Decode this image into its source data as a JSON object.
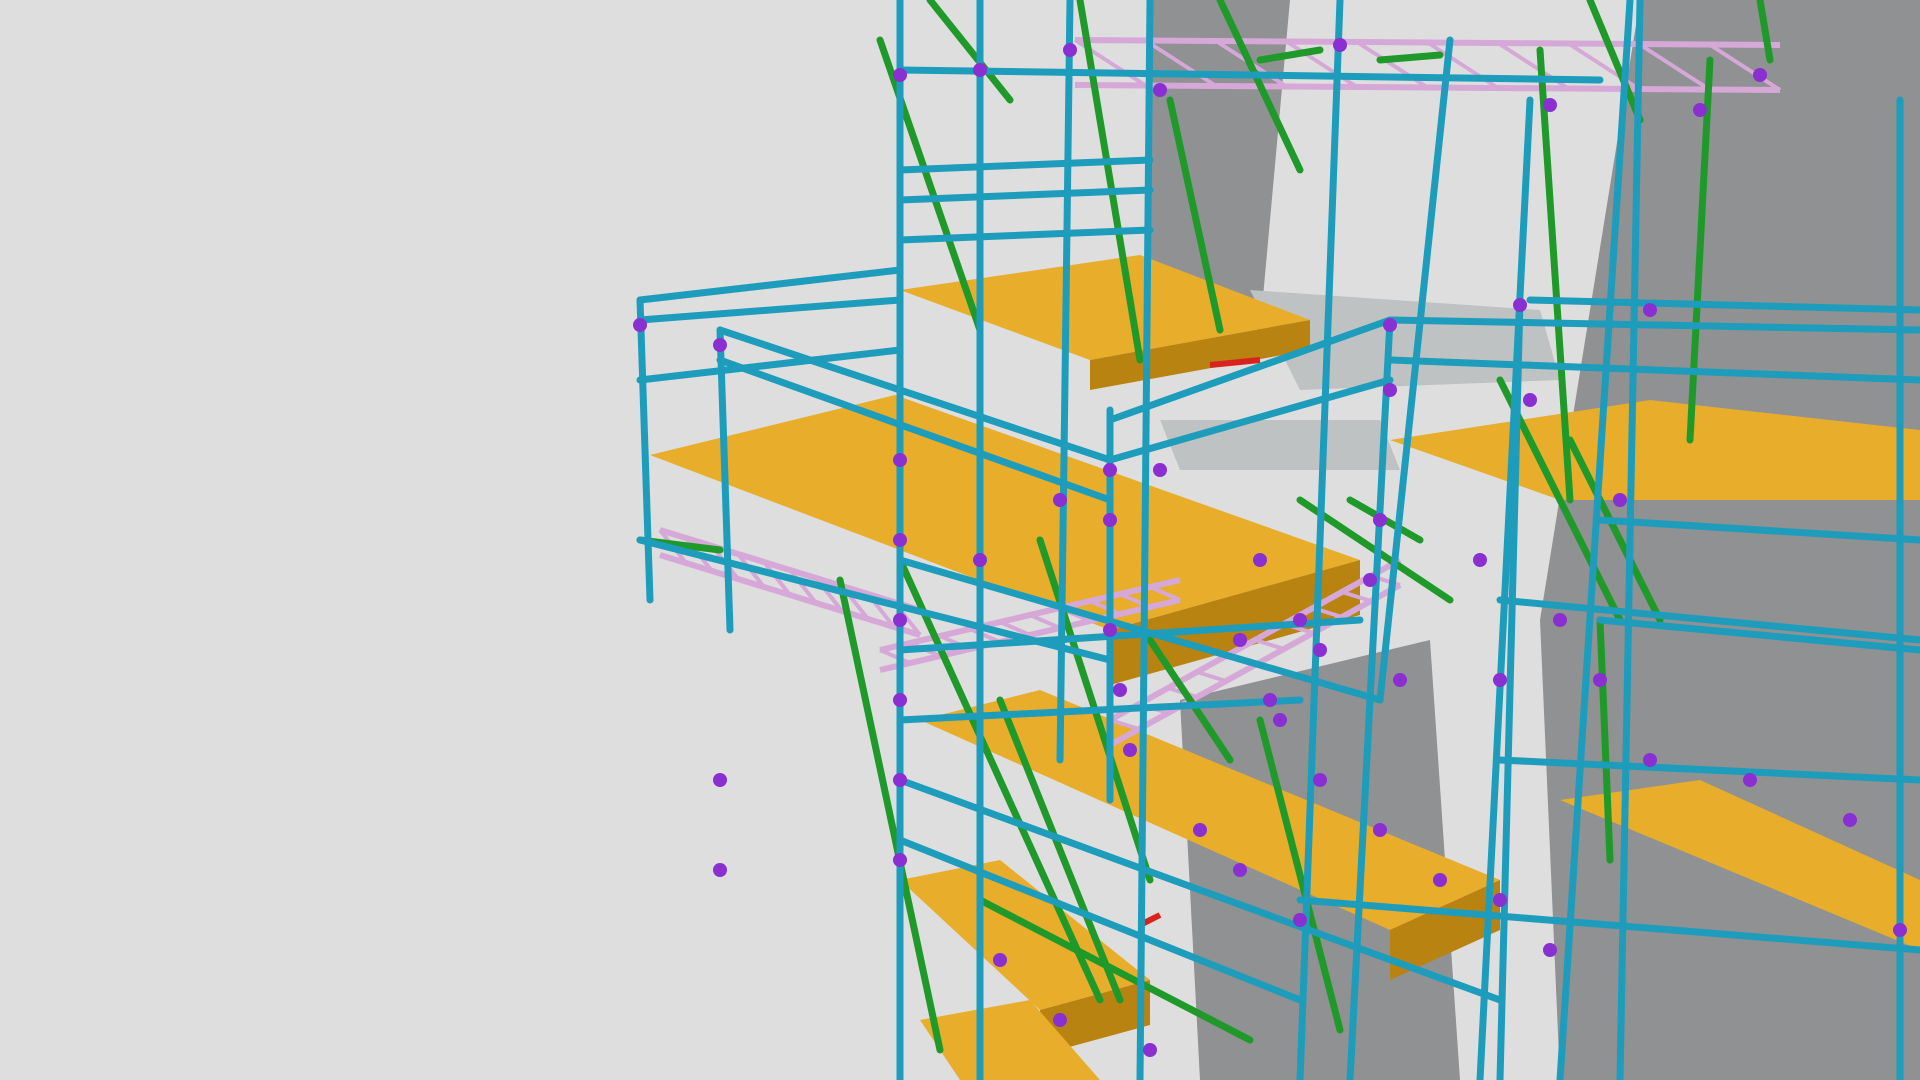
{
  "viewport": {
    "background": "#dedede",
    "tube_color": "#1e9cbc",
    "brace_color": "#1f9a2a",
    "coupler_color": "#8a2fd1",
    "board_color": "#e8ad2a",
    "board_side_color": "#b98312",
    "truss_color": "#d6a8d8",
    "wall_color": "#8f9193",
    "slab_color": "#bfc2c3",
    "accent_red": "#d8231e"
  }
}
